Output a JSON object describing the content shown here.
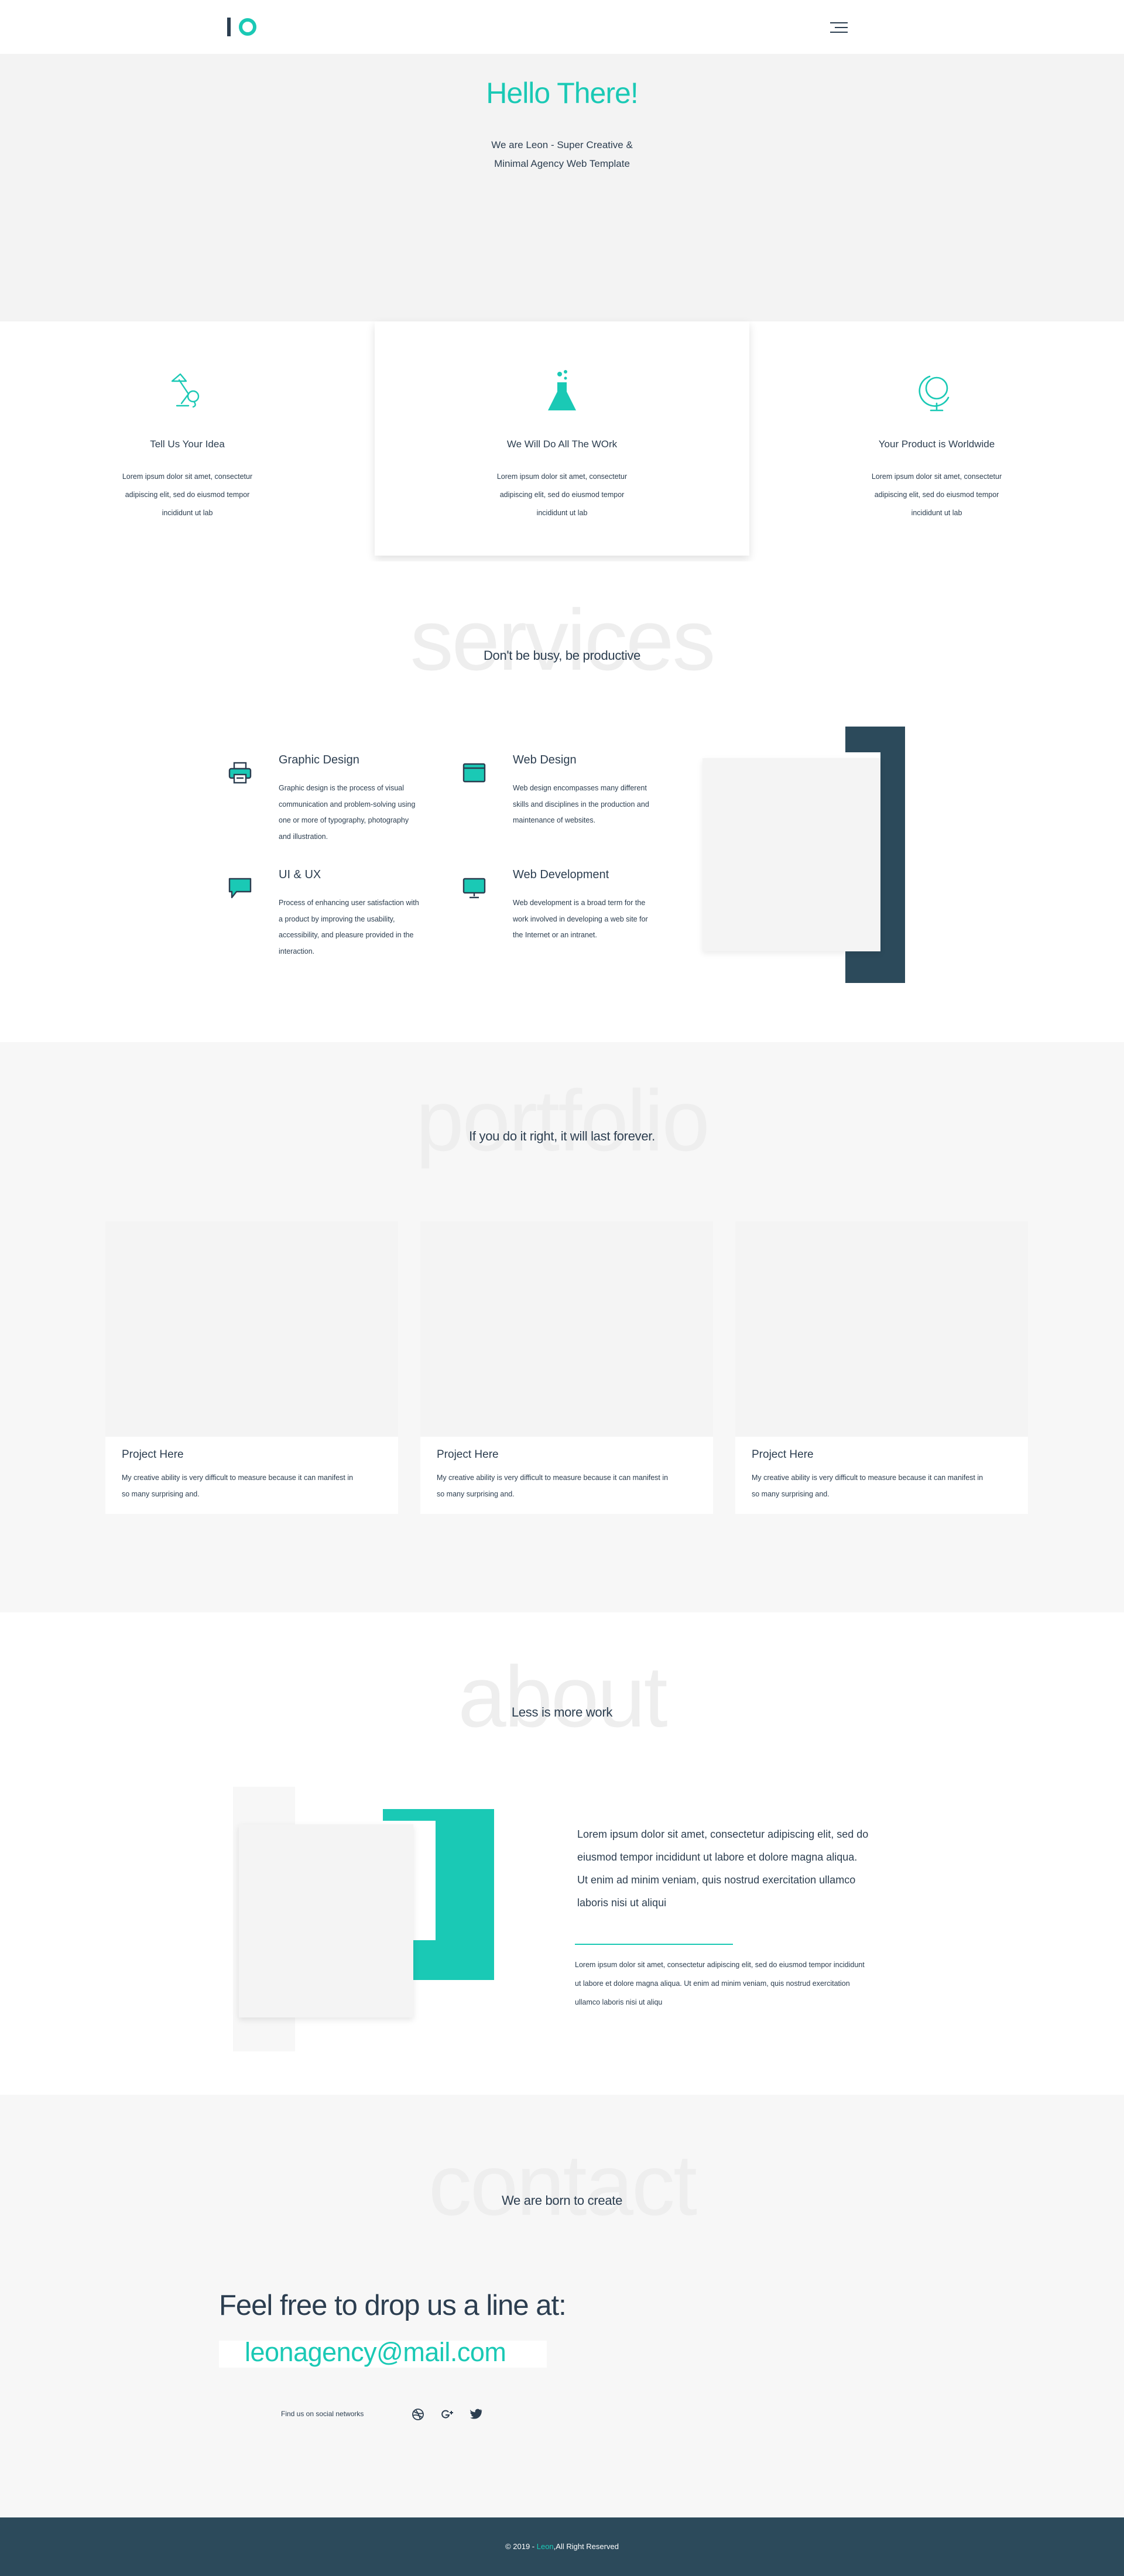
{
  "colors": {
    "accent": "#1ac9b5",
    "dark": "#2c4a5b",
    "text": "#2c3e50"
  },
  "header": {
    "logo_icon": "io-logo",
    "menu_icon": "hamburger-menu-icon"
  },
  "hero": {
    "title": "Hello There!",
    "subtitle": "We are Leon - Super Creative & Minimal Agency Web Template"
  },
  "features": [
    {
      "icon": "desk-lamp-icon",
      "title": "Tell Us Your Idea",
      "text": "Lorem ipsum dolor sit amet, consectetur adipiscing elit, sed do eiusmod tempor incididunt ut lab"
    },
    {
      "icon": "flask-icon",
      "title": "We Will Do All The WOrk",
      "text": "Lorem ipsum dolor sit amet, consectetur adipiscing elit, sed do eiusmod tempor incididunt ut lab"
    },
    {
      "icon": "globe-icon",
      "title": "Your Product is Worldwide",
      "text": "Lorem ipsum dolor sit amet, consectetur adipiscing elit, sed do eiusmod tempor incididunt ut lab"
    }
  ],
  "services": {
    "bg_word": "services",
    "tagline": "Don't be busy, be productive",
    "items": [
      {
        "icon": "printer-icon",
        "title": "Graphic Design",
        "text": "Graphic design is the process of visual communication and problem-solving using one or more of typography, photography and illustration."
      },
      {
        "icon": "browser-window-icon",
        "title": "Web Design",
        "text": "Web design encompasses many different skills and disciplines in the production and maintenance of websites."
      },
      {
        "icon": "chat-bubble-icon",
        "title": "UI & UX",
        "text": "Process of enhancing user satisfaction with a product by improving the usability, accessibility, and pleasure provided in the interaction."
      },
      {
        "icon": "monitor-icon",
        "title": "Web Development",
        "text": "Web development is a broad term for the work involved in developing a web site for the Internet or an intranet."
      }
    ]
  },
  "portfolio": {
    "bg_word": "portfolio",
    "tagline": "If you do it right, it will last forever.",
    "projects": [
      {
        "title": "Project Here",
        "text": "My creative ability is very difficult to measure because it can manifest in so many surprising and."
      },
      {
        "title": "Project Here",
        "text": "My creative ability is very difficult to measure because it can manifest in so many surprising and."
      },
      {
        "title": "Project Here",
        "text": "My creative ability is very difficult to measure because it can manifest in so many surprising and."
      }
    ]
  },
  "about": {
    "bg_word": "about",
    "tagline": "Less is more work",
    "lead": "Lorem ipsum dolor sit amet, consectetur adipiscing elit, sed do eiusmod tempor incididunt ut labore et dolore magna aliqua. Ut enim ad minim veniam, quis nostrud exercitation ullamco laboris nisi ut aliqui",
    "body": "Lorem ipsum dolor sit amet, consectetur adipiscing elit, sed do eiusmod tempor incididunt ut labore et dolore magna aliqua. Ut enim ad minim veniam, quis nostrud exercitation ullamco laboris nisi ut aliqu"
  },
  "contact": {
    "bg_word": "contact",
    "tagline": "We are born to create",
    "heading": "Feel free to drop us a line at:",
    "email": "leonagency@mail.com",
    "social_label": "Find us on social networks",
    "social_icons": [
      "dribbble-icon",
      "google-plus-icon",
      "twitter-icon"
    ]
  },
  "footer": {
    "prefix": "© 2019 - ",
    "brand": "Leon",
    "suffix": ",All Right Reserved"
  }
}
